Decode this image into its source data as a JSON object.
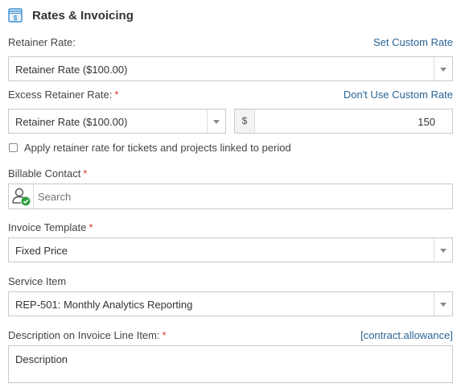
{
  "section": {
    "title": "Rates & Invoicing",
    "icon": "invoice-icon"
  },
  "retainer_rate": {
    "label": "Retainer Rate:",
    "link": "Set Custom Rate",
    "value": "Retainer Rate ($100.00)"
  },
  "excess_retainer_rate": {
    "label": "Excess Retainer Rate:",
    "required": "*",
    "link": "Don't Use Custom Rate",
    "value": "Retainer Rate ($100.00)",
    "currency_symbol": "$",
    "amount": "150"
  },
  "apply_retainer": {
    "label": "Apply retainer rate for tickets and projects linked to period",
    "checked": false
  },
  "billable_contact": {
    "label": "Billable Contact",
    "required": "*",
    "placeholder": "Search",
    "icon": "contact-check-icon"
  },
  "invoice_template": {
    "label": "Invoice Template",
    "required": "*",
    "value": "Fixed Price"
  },
  "service_item": {
    "label": "Service Item",
    "value": "REP-501: Monthly Analytics Reporting"
  },
  "description": {
    "label": "Description on Invoice Line Item:",
    "required": "*",
    "link": "[contract.allowance]",
    "value": "Description"
  },
  "colors": {
    "link": "#2a6496",
    "required": "#d9382b",
    "icon_blue": "#3a8fd0",
    "check_green": "#2e9d3f"
  }
}
